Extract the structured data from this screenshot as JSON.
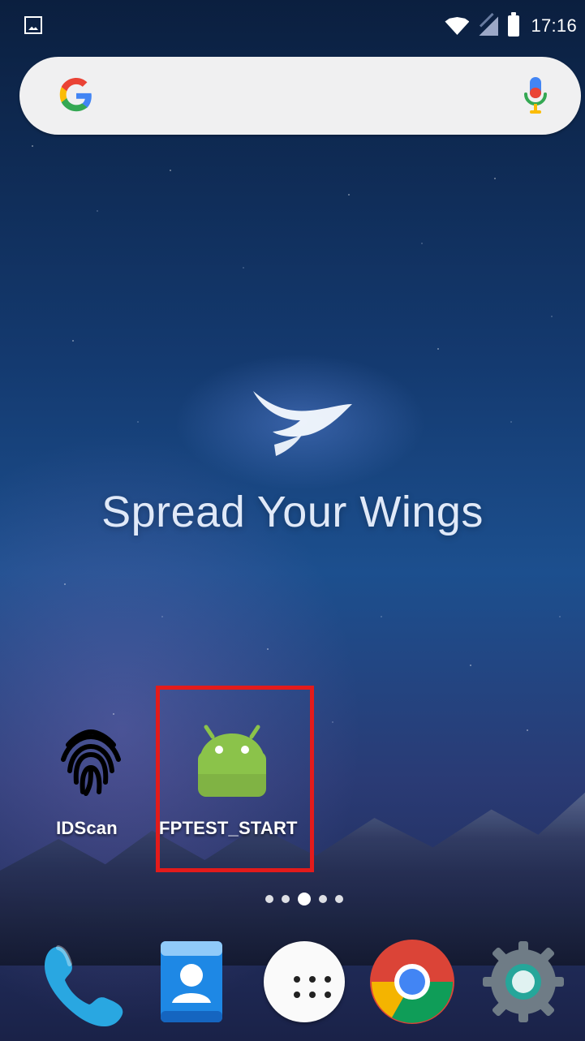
{
  "status_bar": {
    "time": "17:16",
    "icons": [
      "gallery-notification-icon",
      "wifi-icon",
      "signal-icon",
      "battery-icon"
    ]
  },
  "search": {
    "icons": [
      "google-g-icon",
      "microphone-icon"
    ]
  },
  "wallpaper": {
    "tagline": "Spread Your Wings",
    "logo_icon": "bird-logo-icon"
  },
  "home_apps": [
    {
      "label": "IDScan",
      "icon": "fingerprint-icon"
    },
    {
      "label": "FPTEST_START",
      "icon": "android-icon"
    }
  ],
  "page_indicator": {
    "count": 5,
    "active_index": 2
  },
  "dock": {
    "items": [
      {
        "icon": "phone-icon"
      },
      {
        "icon": "contacts-icon"
      },
      {
        "icon": "app-drawer-icon"
      },
      {
        "icon": "chrome-icon"
      },
      {
        "icon": "settings-icon"
      }
    ]
  },
  "colors": {
    "highlight": "#E31B1B",
    "android_green": "#8BC34A",
    "phone_blue": "#29A7E1"
  }
}
